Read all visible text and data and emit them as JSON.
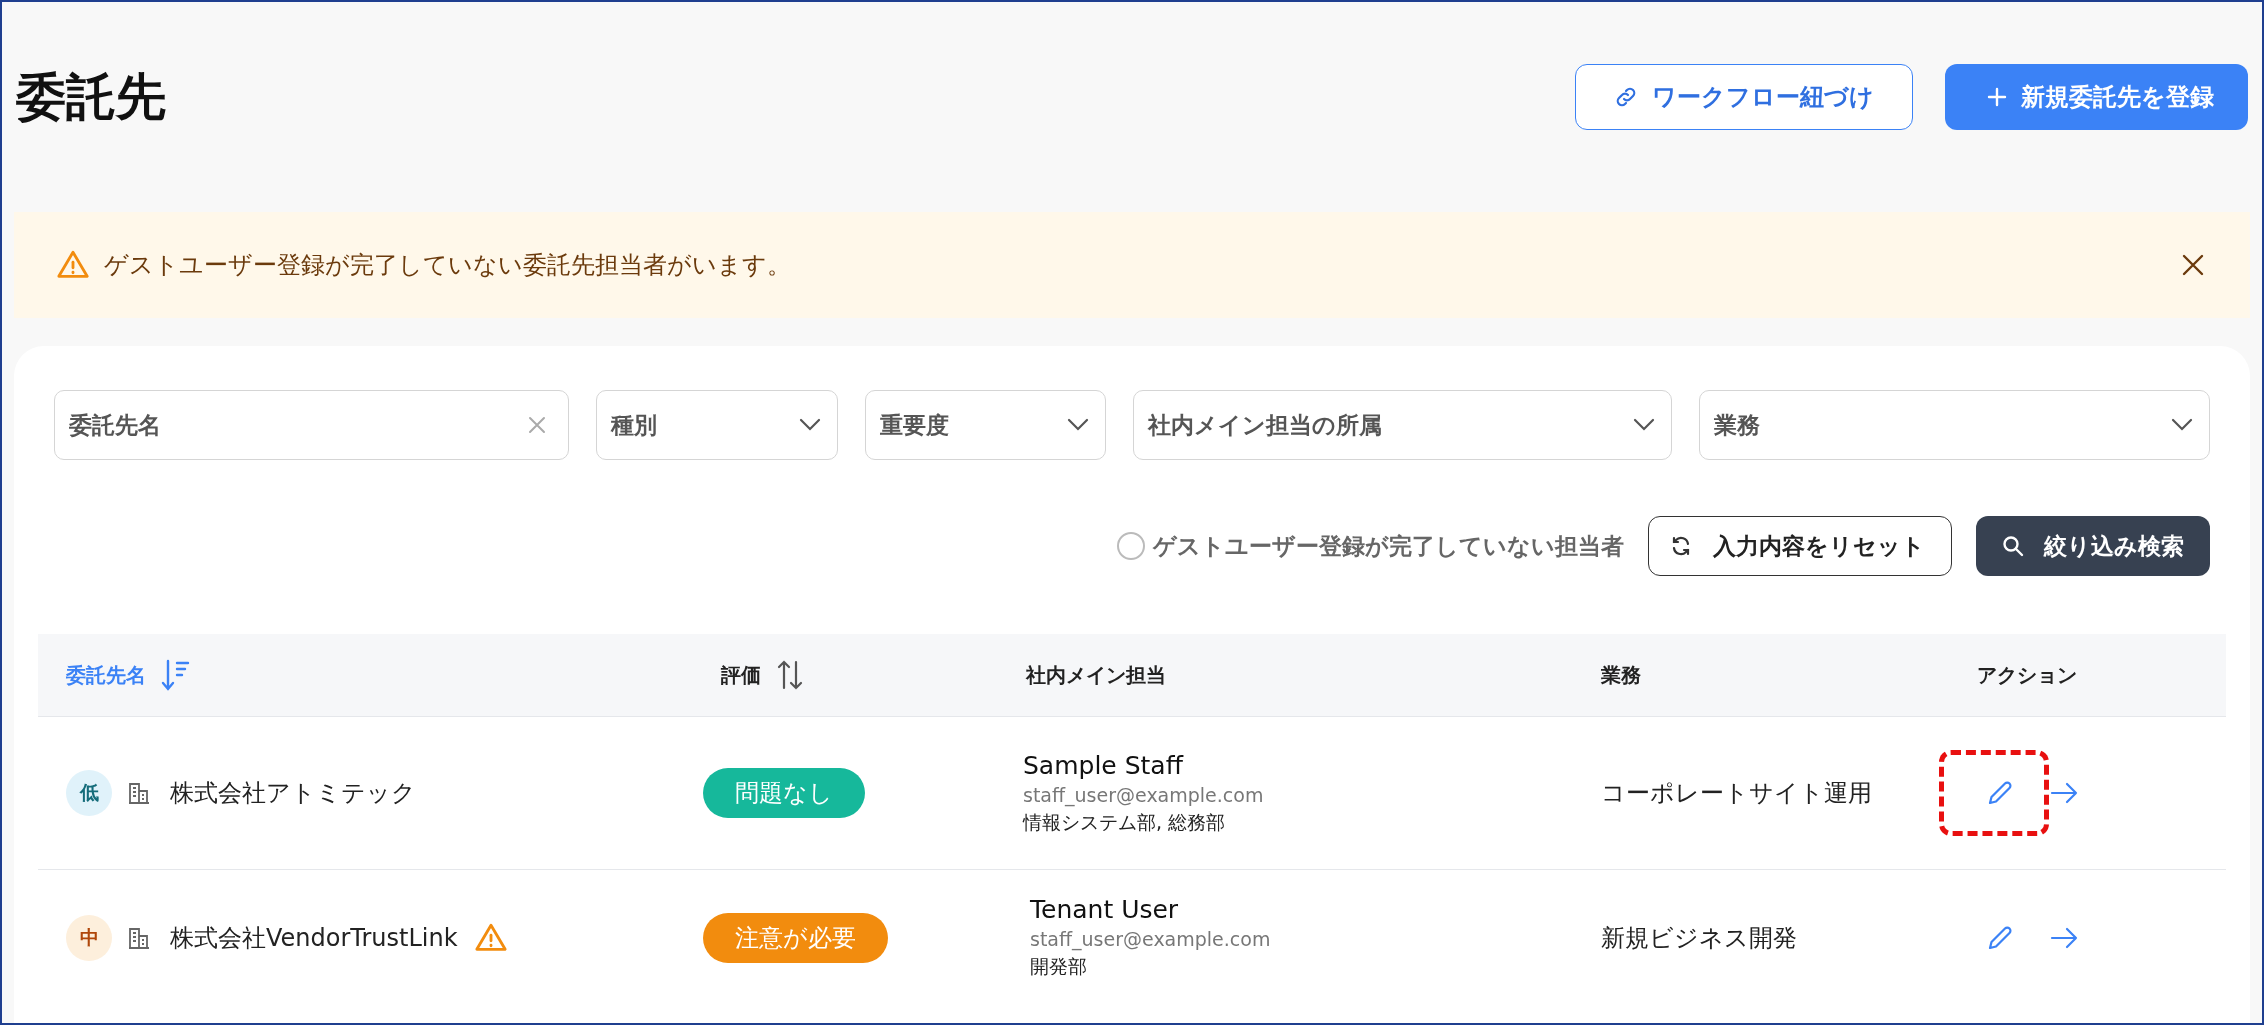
{
  "page": {
    "title": "委託先"
  },
  "header_buttons": [
    {
      "kind": "link",
      "label": "ワークフロー紐づけ"
    },
    {
      "kind": "add",
      "label": "新規委託先を登録"
    }
  ],
  "alert": {
    "message": "ゲストユーザー登録が完了していない委託先担当者がいます。"
  },
  "filters": [
    {
      "kind": "text",
      "placeholder": "委託先名"
    },
    {
      "kind": "select",
      "placeholder": "種別"
    },
    {
      "kind": "select",
      "placeholder": "重要度"
    },
    {
      "kind": "select",
      "placeholder": "社内メイン担当の所属"
    },
    {
      "kind": "select",
      "placeholder": "業務"
    }
  ],
  "guest_filter": {
    "label": "ゲストユーザー登録が完了していない担当者",
    "checked": false
  },
  "reset_button": "入力内容をリセット",
  "search_button": "絞り込み検索",
  "table": {
    "columns": [
      {
        "label": "委託先名",
        "sortable": true,
        "sorted": true
      },
      {
        "label": "評価",
        "sortable": true,
        "sorted": false
      },
      {
        "label": "社内メイン担当",
        "sortable": false,
        "sorted": false
      },
      {
        "label": "業務",
        "sortable": false,
        "sorted": false
      },
      {
        "label": "アクション",
        "sortable": false,
        "sorted": false
      }
    ],
    "rows": [
      {
        "priority": {
          "label": "低",
          "kind": "low"
        },
        "name": "株式会社アトミテック",
        "warning": false,
        "rating": {
          "label": "問題なし",
          "kind": "ok"
        },
        "staff_name": "Sample Staff",
        "staff_email": "staff_user@example.com",
        "staff_dept": "情報システム部, 総務部",
        "business": "コーポレートサイト運用",
        "edit_highlighted": true
      },
      {
        "priority": {
          "label": "中",
          "kind": "medium"
        },
        "name": "株式会社VendorTrustLink",
        "warning": true,
        "rating": {
          "label": "注意が必要",
          "kind": "caution"
        },
        "staff_name": "Tenant User",
        "staff_email": "staff_user@example.com",
        "staff_dept": "開発部",
        "business": "新規ビジネス開発",
        "edit_highlighted": false
      }
    ]
  }
}
